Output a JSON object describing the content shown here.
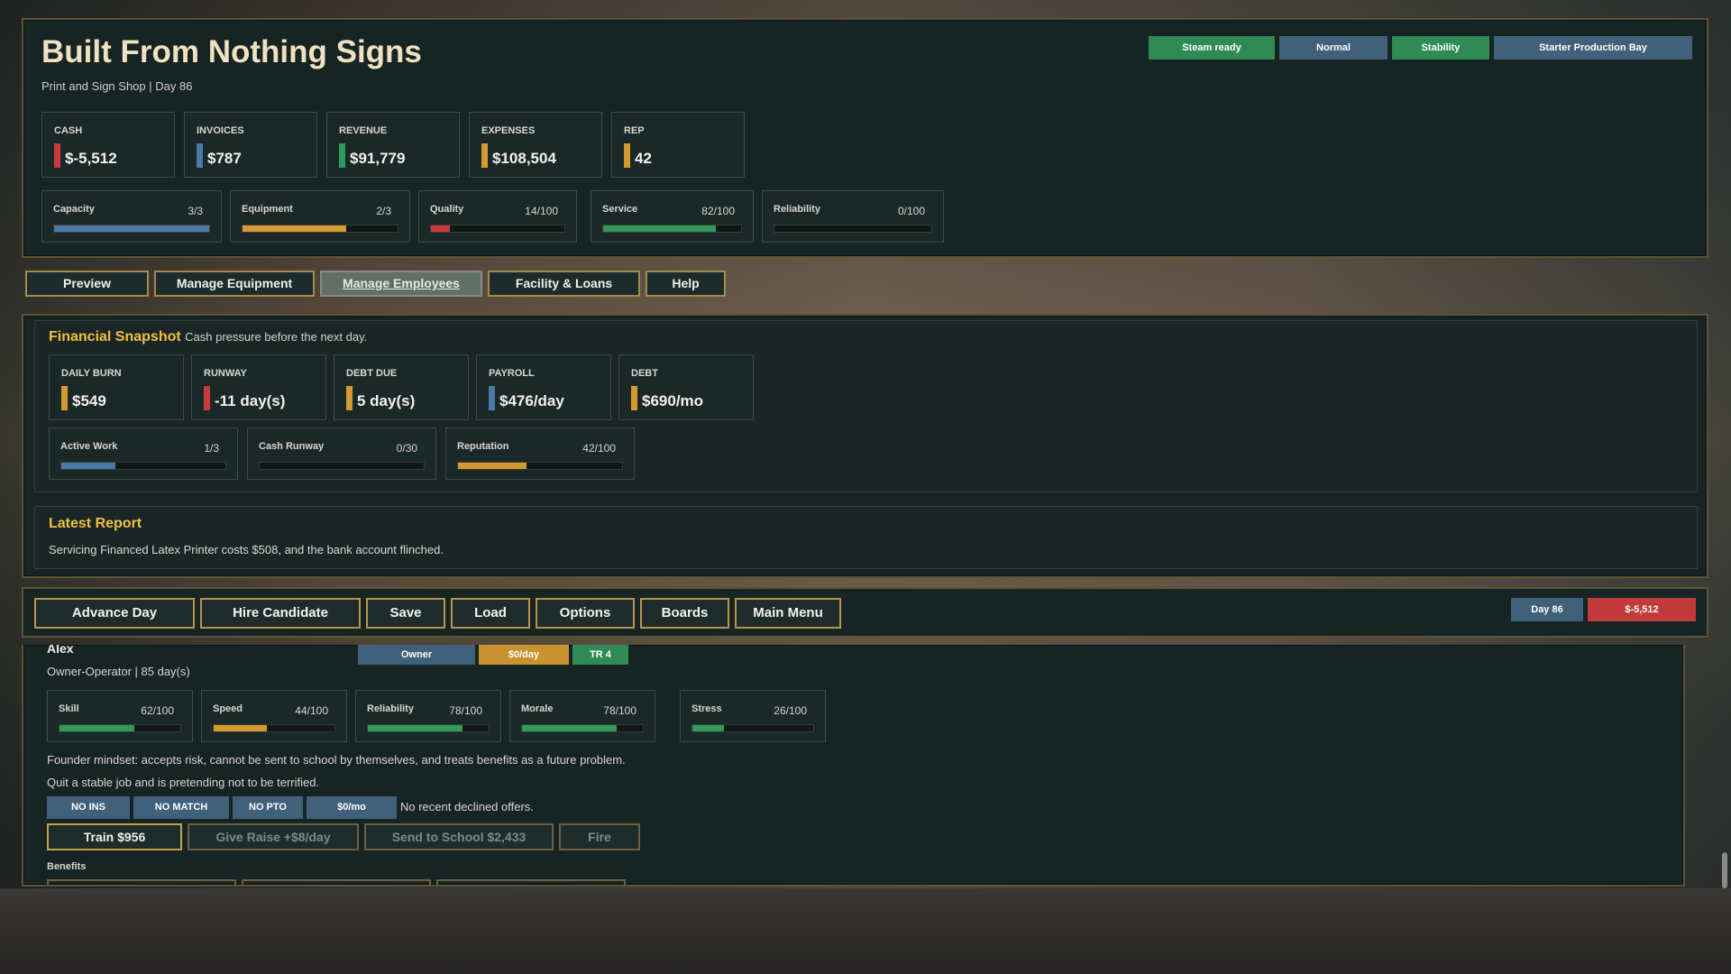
{
  "header": {
    "title": "Built From Nothing Signs",
    "subtitle": "Print and Sign Shop | Day 86",
    "tags": [
      {
        "label": "Steam ready",
        "color": "#2f8a56"
      },
      {
        "label": "Normal",
        "color": "#41607a"
      },
      {
        "label": "Stability",
        "color": "#2f8a56"
      },
      {
        "label": "Starter Production Bay",
        "color": "#41607a"
      }
    ]
  },
  "stats": [
    {
      "label": "CASH",
      "value": "$-5,512",
      "accent": "#c83a3a"
    },
    {
      "label": "INVOICES",
      "value": "$787",
      "accent": "#4a7aa8"
    },
    {
      "label": "REVENUE",
      "value": "$91,779",
      "accent": "#2f9a5a"
    },
    {
      "label": "EXPENSES",
      "value": "$108,504",
      "accent": "#d49a30"
    },
    {
      "label": "REP",
      "value": "42",
      "accent": "#d49a30"
    }
  ],
  "meters": [
    {
      "label": "Capacity",
      "value": "3/3",
      "fraction": 1.0,
      "color": "#4a7aa8"
    },
    {
      "label": "Equipment",
      "value": "2/3",
      "fraction": 0.67,
      "color": "#d49a30"
    },
    {
      "label": "Quality",
      "value": "14/100",
      "fraction": 0.14,
      "color": "#c83a3a"
    },
    {
      "label": "Service",
      "value": "82/100",
      "fraction": 0.82,
      "color": "#2f9a5a"
    },
    {
      "label": "Reliability",
      "value": "0/100",
      "fraction": 0.0,
      "color": "#4a7aa8"
    }
  ],
  "nav": {
    "items": [
      "Preview",
      "Manage Equipment",
      "Manage Employees",
      "Facility & Loans",
      "Help"
    ],
    "active": "Manage Employees"
  },
  "financial": {
    "title": "Financial Snapshot",
    "subtitle": "Cash pressure before the next day.",
    "stats": [
      {
        "label": "DAILY BURN",
        "value": "$549",
        "accent": "#d49a30"
      },
      {
        "label": "RUNWAY",
        "value": "-11 day(s)",
        "accent": "#c83a3a"
      },
      {
        "label": "DEBT DUE",
        "value": "5 day(s)",
        "accent": "#d49a30"
      },
      {
        "label": "PAYROLL",
        "value": "$476/day",
        "accent": "#4a7aa8"
      },
      {
        "label": "DEBT",
        "value": "$690/mo",
        "accent": "#d49a30"
      }
    ],
    "meters": [
      {
        "label": "Active Work",
        "value": "1/3",
        "fraction": 0.33,
        "color": "#4a7aa8"
      },
      {
        "label": "Cash Runway",
        "value": "0/30",
        "fraction": 0.0,
        "color": "#4a7aa8"
      },
      {
        "label": "Reputation",
        "value": "42/100",
        "fraction": 0.42,
        "color": "#d49a30"
      }
    ]
  },
  "report": {
    "title": "Latest Report",
    "text": "Servicing Financed Latex Printer costs $508, and the bank account flinched."
  },
  "actions": [
    "Advance Day",
    "Hire Candidate",
    "Save",
    "Load",
    "Options",
    "Boards",
    "Main Menu"
  ],
  "status": {
    "day": "Day 86",
    "cash": "$-5,512"
  },
  "employee": {
    "name": "Alex",
    "role": "Owner-Operator | 85 day(s)",
    "badges": [
      {
        "label": "Owner",
        "color": "#41607a"
      },
      {
        "label": "$0/day",
        "color": "#c8922e"
      },
      {
        "label": "TR 4",
        "color": "#2f8a56"
      }
    ],
    "meters": [
      {
        "label": "Skill",
        "value": "62/100",
        "fraction": 0.62,
        "color": "#2f9a5a"
      },
      {
        "label": "Speed",
        "value": "44/100",
        "fraction": 0.44,
        "color": "#d49a30"
      },
      {
        "label": "Reliability",
        "value": "78/100",
        "fraction": 0.78,
        "color": "#2f9a5a"
      },
      {
        "label": "Morale",
        "value": "78/100",
        "fraction": 0.78,
        "color": "#2f9a5a"
      },
      {
        "label": "Stress",
        "value": "26/100",
        "fraction": 0.26,
        "color": "#2f9a5a"
      }
    ],
    "note1": "Founder mindset: accepts risk, cannot be sent to school by themselves, and treats benefits as a future problem.",
    "note2": "Quit a stable job and is pretending not to be terrified.",
    "chips": [
      "NO INS",
      "NO MATCH",
      "NO PTO",
      "$0/mo"
    ],
    "declined": "No recent declined offers.",
    "buttons": [
      "Train $956",
      "Give Raise +$8/day",
      "Send to School $2,433",
      "Fire"
    ],
    "benefits_label": "Benefits"
  }
}
